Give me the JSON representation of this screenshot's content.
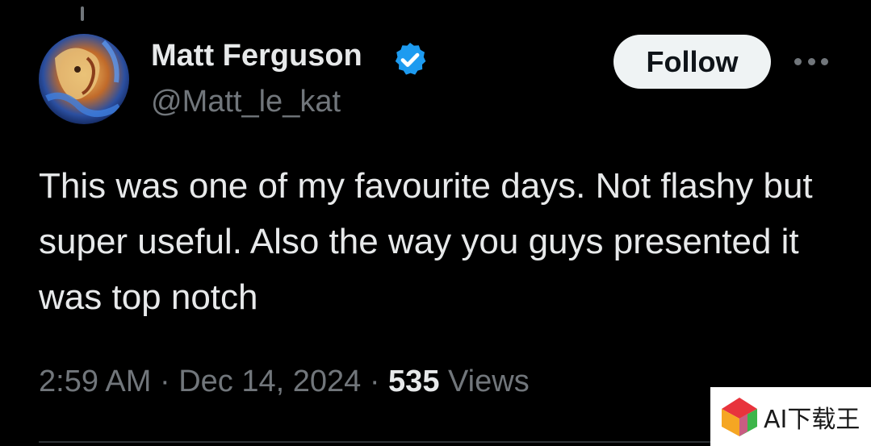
{
  "author": {
    "display_name": "Matt Ferguson",
    "handle": "@Matt_le_kat",
    "verified": true,
    "avatar_icon": "profile-avatar-icon"
  },
  "actions": {
    "follow_label": "Follow",
    "more_icon": "more-options-icon"
  },
  "tweet": {
    "text": "This was one of my favourite days. Not flashy but super useful. Also the way you guys presented it was top notch",
    "time": "2:59 AM",
    "separator": " · ",
    "date": "Dec 14, 2024",
    "views_count": "535",
    "views_label": "Views"
  },
  "watermark": {
    "text": "AI下载王"
  },
  "colors": {
    "background": "#000000",
    "primary_text": "#e7e9ea",
    "secondary_text": "#71767b",
    "verified_badge": "#1d9bf0",
    "follow_button_bg": "#eff3f4"
  }
}
